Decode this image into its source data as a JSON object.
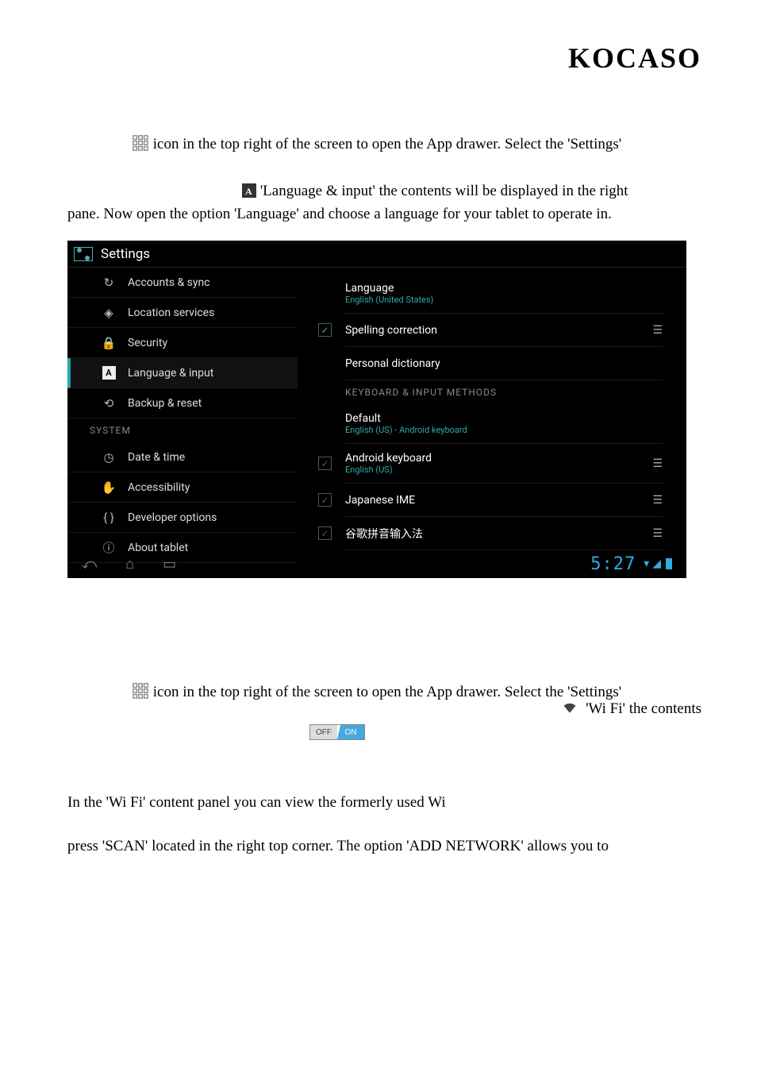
{
  "brand": "KOCASO",
  "p1": " icon in the top right of the screen to open the App drawer. Select the 'Settings'",
  "p2a": "  'Language & input' the contents will be displayed in the right",
  "p2b": "pane. Now open the option 'Language' and choose a language for your tablet to operate in.",
  "shot": {
    "title": "Settings",
    "sidebar": [
      {
        "icon": "sync",
        "label": "Accounts & sync"
      },
      {
        "icon": "loc",
        "label": "Location services"
      },
      {
        "icon": "lock",
        "label": "Security"
      },
      {
        "icon": "A",
        "label": "Language & input",
        "selected": true
      },
      {
        "icon": "backup",
        "label": "Backup & reset"
      }
    ],
    "sidebar_header": "SYSTEM",
    "sidebar2": [
      {
        "icon": "clock",
        "label": "Date & time"
      },
      {
        "icon": "hand",
        "label": "Accessibility"
      },
      {
        "icon": "braces",
        "label": "Developer options"
      },
      {
        "icon": "info",
        "label": "About tablet"
      }
    ],
    "content": {
      "language": {
        "title": "Language",
        "sub": "English (United States)"
      },
      "spelling": "Spelling correction",
      "dictionary": "Personal dictionary",
      "header": "KEYBOARD & INPUT METHODS",
      "default": {
        "title": "Default",
        "sub": "English (US) - Android keyboard"
      },
      "android_kb": {
        "title": "Android keyboard",
        "sub": "English (US)"
      },
      "jp": "Japanese IME",
      "cn": "谷歌拼音输入法"
    },
    "clock": "5:27"
  },
  "p3": " icon in the top right of the screen to open the App drawer. Select the 'Settings'",
  "p3b": " 'Wi Fi' the contents",
  "toggle": {
    "off": "OFF",
    "on": "ON"
  },
  "p4": "In the 'Wi Fi' content panel you can view the formerly used Wi",
  "p5": "press 'SCAN' located in the right top corner. The option 'ADD NETWORK' allows you to"
}
